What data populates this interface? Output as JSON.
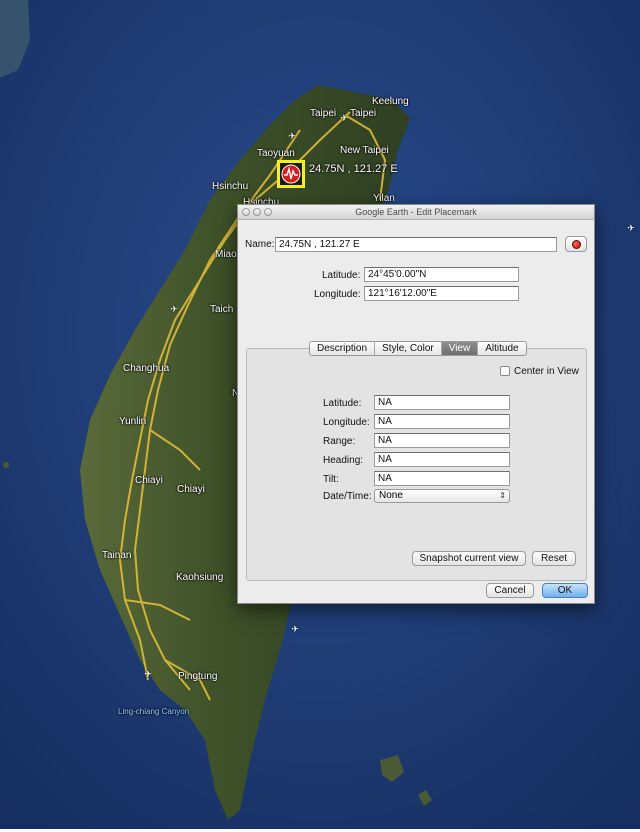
{
  "map": {
    "placemark_label": "24.75N , 121.27 E",
    "places": [
      {
        "key": "keelung",
        "name": "Keelung"
      },
      {
        "key": "taipei",
        "name": "Taipei"
      },
      {
        "key": "taipei2",
        "name": "Taipei"
      },
      {
        "key": "new_taipei",
        "name": "New Taipei"
      },
      {
        "key": "taoyuan",
        "name": "Taoyuan"
      },
      {
        "key": "hsinchu",
        "name": "Hsinchu"
      },
      {
        "key": "hsinchu2",
        "name": "Hsinchu"
      },
      {
        "key": "yilan",
        "name": "Yilan"
      },
      {
        "key": "miao",
        "name": "Miao"
      },
      {
        "key": "taichung",
        "name": "Taich"
      },
      {
        "key": "changhua",
        "name": "Changhua"
      },
      {
        "key": "n_frag",
        "name": "N"
      },
      {
        "key": "yunlin",
        "name": "Yunlin"
      },
      {
        "key": "chiayi",
        "name": "Chiayi"
      },
      {
        "key": "chiayi2",
        "name": "Chiayi"
      },
      {
        "key": "tainan",
        "name": "Tainan"
      },
      {
        "key": "kaohsiung",
        "name": "Kaohsiung"
      },
      {
        "key": "pingtung",
        "name": "Pingtung"
      },
      {
        "key": "canyon",
        "name": "Ling-chiang Canyon"
      }
    ],
    "colors": {
      "ocean": "#1d3a73",
      "land": "#3d4a2a",
      "roads": "#e8c23a",
      "marker_border": "#f4f21a"
    }
  },
  "dialog": {
    "title": "Google Earth - Edit Placemark",
    "name_label": "Name:",
    "name_value": "24.75N , 121.27 E",
    "latitude_label": "Latitude:",
    "latitude_value": "24°45'0.00\"N",
    "longitude_label": "Longitude:",
    "longitude_value": "121°16'12.00\"E",
    "tabs": [
      {
        "label": "Description",
        "active": false
      },
      {
        "label": "Style, Color",
        "active": false
      },
      {
        "label": "View",
        "active": true
      },
      {
        "label": "Altitude",
        "active": false
      }
    ],
    "view": {
      "center_in_view": "Center in View",
      "latitude_label": "Latitude:",
      "latitude_value": "NA",
      "longitude_label": "Longitude:",
      "longitude_value": "NA",
      "range_label": "Range:",
      "range_value": "NA",
      "heading_label": "Heading:",
      "heading_value": "NA",
      "tilt_label": "Tilt:",
      "tilt_value": "NA",
      "datetime_label": "Date/Time:",
      "datetime_value": "None",
      "snapshot_label": "Snapshot current view",
      "reset_label": "Reset"
    },
    "cancel_label": "Cancel",
    "ok_label": "OK"
  }
}
